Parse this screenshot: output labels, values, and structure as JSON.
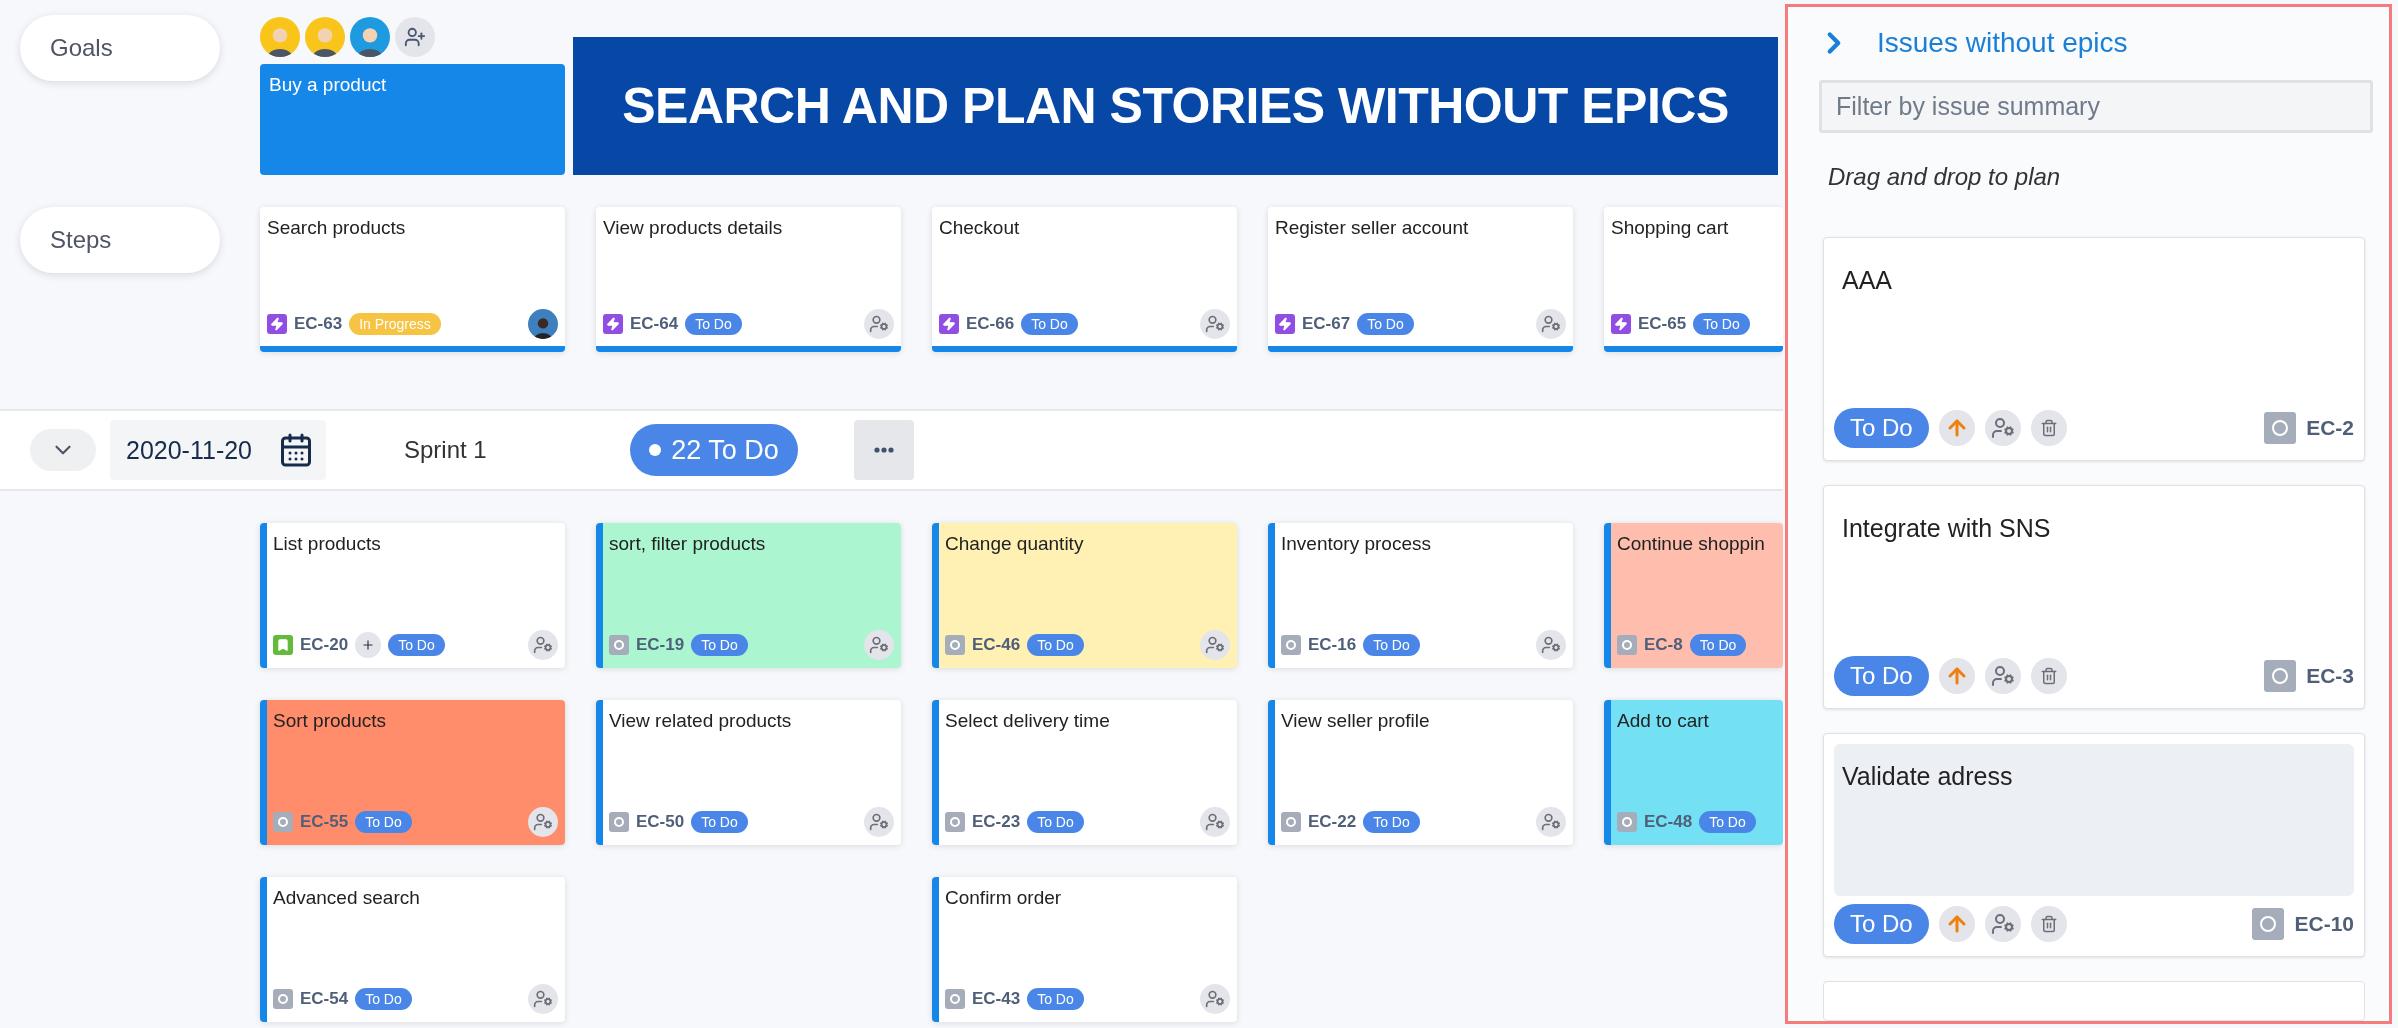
{
  "labels": {
    "goals": "Goals",
    "steps": "Steps"
  },
  "members": [
    {
      "kind": "person",
      "color": "#f9c51a"
    },
    {
      "kind": "person",
      "color": "#f9c51a"
    },
    {
      "kind": "person",
      "color": "#1e9be0"
    },
    {
      "kind": "add"
    }
  ],
  "goal": {
    "title": "Buy a product"
  },
  "banner": "SEARCH AND PLAN STORIES WITHOUT EPICS",
  "steps": [
    {
      "title": "Search products",
      "key": "EC-63",
      "kind": "epic",
      "status": {
        "text": "In Progress",
        "color": "#f6c342"
      },
      "assignee": {
        "kind": "avatar"
      }
    },
    {
      "title": "View products details",
      "key": "EC-64",
      "kind": "epic",
      "status": {
        "text": "To Do",
        "color": "#4a86e8"
      },
      "assignee": {
        "kind": "unassigned"
      }
    },
    {
      "title": "Checkout",
      "key": "EC-66",
      "kind": "epic",
      "status": {
        "text": "To Do",
        "color": "#4a86e8"
      },
      "assignee": {
        "kind": "unassigned"
      }
    },
    {
      "title": "Register seller account",
      "key": "EC-67",
      "kind": "epic",
      "status": {
        "text": "To Do",
        "color": "#4a86e8"
      },
      "assignee": {
        "kind": "unassigned"
      }
    },
    {
      "title": "Shopping cart",
      "key": "EC-65",
      "kind": "epic",
      "status": {
        "text": "To Do",
        "color": "#4a86e8"
      }
    }
  ],
  "sprint": {
    "date": "2020-11-20",
    "name": "Sprint 1",
    "count": "22 To Do"
  },
  "columns": [
    [
      {
        "title": "List products",
        "key": "EC-20",
        "kind": "story",
        "status": {
          "text": "To Do",
          "color": "#4a86e8"
        },
        "color": "#ffffff",
        "assignee": {
          "kind": "unassigned"
        },
        "add_button": true
      },
      {
        "title": "Sort products",
        "key": "EC-55",
        "kind": "task",
        "status": {
          "text": "To Do",
          "color": "#4a86e8"
        },
        "color": "#ff8c6b",
        "assignee": {
          "kind": "unassigned"
        }
      },
      {
        "title": "Advanced search",
        "key": "EC-54",
        "kind": "task",
        "status": {
          "text": "To Do",
          "color": "#4a86e8"
        },
        "color": "#ffffff",
        "assignee": {
          "kind": "unassigned"
        }
      }
    ],
    [
      {
        "title": "sort, filter products",
        "key": "EC-19",
        "kind": "task",
        "status": {
          "text": "To Do",
          "color": "#4a86e8"
        },
        "color": "#abf5d1",
        "assignee": {
          "kind": "unassigned"
        }
      },
      {
        "title": "View related products",
        "key": "EC-50",
        "kind": "task",
        "status": {
          "text": "To Do",
          "color": "#4a86e8"
        },
        "color": "#ffffff",
        "assignee": {
          "kind": "unassigned"
        }
      }
    ],
    [
      {
        "title": "Change quantity",
        "key": "EC-46",
        "kind": "task",
        "status": {
          "text": "To Do",
          "color": "#4a86e8"
        },
        "color": "#fff0b3",
        "assignee": {
          "kind": "unassigned"
        }
      },
      {
        "title": "Select delivery time",
        "key": "EC-23",
        "kind": "task",
        "status": {
          "text": "To Do",
          "color": "#4a86e8"
        },
        "color": "#ffffff",
        "assignee": {
          "kind": "unassigned"
        }
      },
      {
        "title": "Confirm order",
        "key": "EC-43",
        "kind": "task",
        "status": {
          "text": "To Do",
          "color": "#4a86e8"
        },
        "color": "#ffffff",
        "assignee": {
          "kind": "unassigned"
        }
      }
    ],
    [
      {
        "title": "Inventory process",
        "key": "EC-16",
        "kind": "task",
        "status": {
          "text": "To Do",
          "color": "#4a86e8"
        },
        "color": "#ffffff",
        "assignee": {
          "kind": "unassigned"
        }
      },
      {
        "title": "View seller profile",
        "key": "EC-22",
        "kind": "task",
        "status": {
          "text": "To Do",
          "color": "#4a86e8"
        },
        "color": "#ffffff",
        "assignee": {
          "kind": "unassigned"
        }
      }
    ],
    [
      {
        "title": "Continue shoppin",
        "key": "EC-8",
        "kind": "task",
        "status": {
          "text": "To Do",
          "color": "#4a86e8"
        },
        "color": "#ffbdad"
      },
      {
        "title": "Add to cart",
        "key": "EC-48",
        "kind": "task",
        "status": {
          "text": "To Do",
          "color": "#4a86e8"
        },
        "color": "#73e0f3"
      }
    ]
  ],
  "panel": {
    "title": "Issues without epics",
    "filter_placeholder": "Filter by issue summary",
    "hint": "Drag and drop to plan",
    "issues": [
      {
        "title": "AAA",
        "status": "To Do",
        "key": "EC-2",
        "kind": "task",
        "highlighted": false
      },
      {
        "title": "Integrate with SNS",
        "status": "To Do",
        "key": "EC-3",
        "kind": "task",
        "highlighted": false
      },
      {
        "title": "Validate adress",
        "status": "To Do",
        "key": "EC-10",
        "kind": "task",
        "highlighted": true
      }
    ]
  }
}
